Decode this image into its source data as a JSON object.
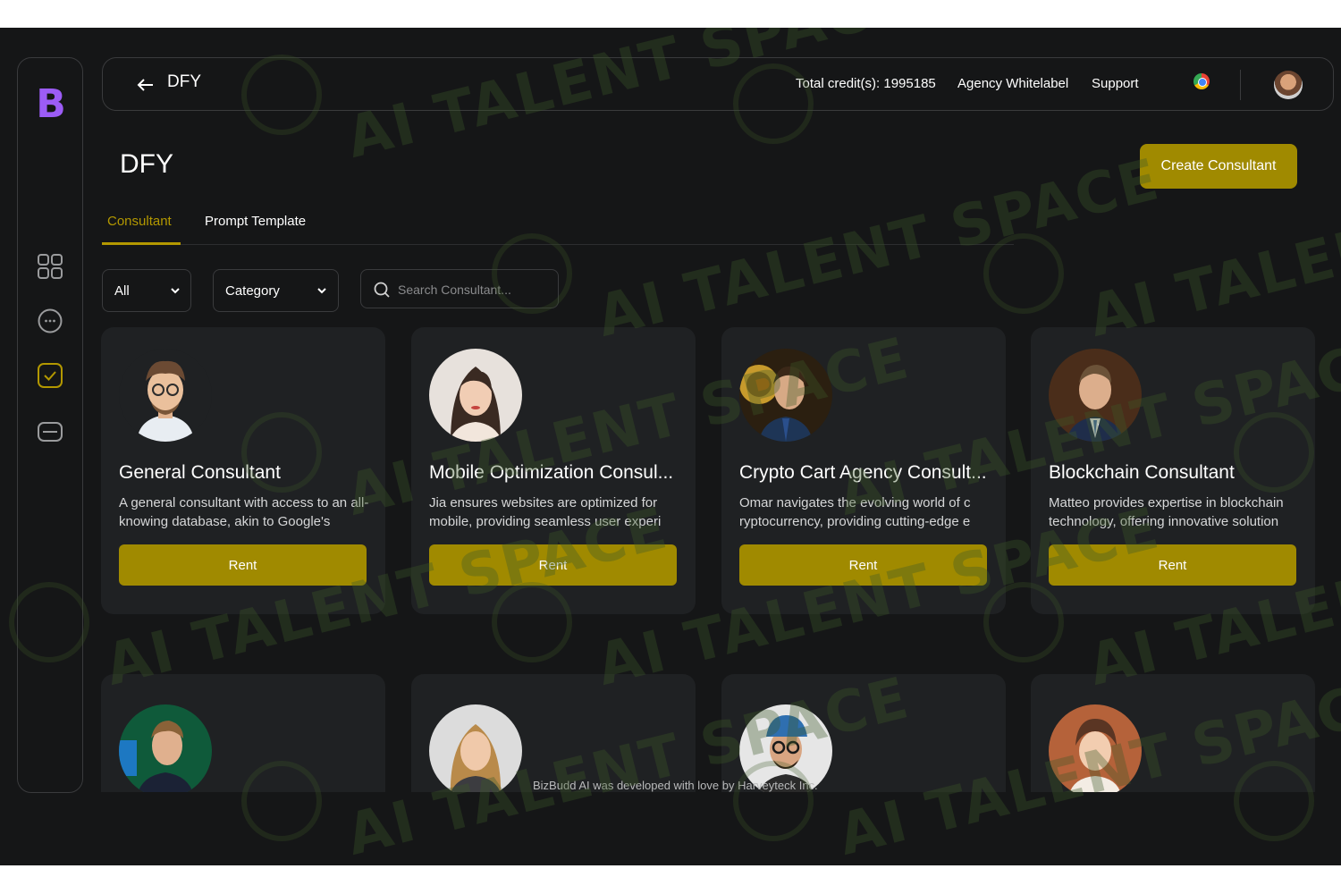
{
  "brand": {
    "logo_letter": "B",
    "accent": "#a08a00",
    "tab_accent": "#b39800",
    "logo_color": "#9c5cf6"
  },
  "sidebar": {
    "items": [
      {
        "icon": "grid-icon"
      },
      {
        "icon": "chat-bubble-icon"
      },
      {
        "icon": "check-square-icon",
        "active": true
      },
      {
        "icon": "card-icon"
      }
    ]
  },
  "topbar": {
    "title": "DFY",
    "credits": "Total credit(s): 1995185",
    "links": [
      "Agency Whitelabel",
      "Support"
    ]
  },
  "page": {
    "title": "DFY",
    "create_button": "Create Consultant"
  },
  "tabs": [
    {
      "label": "Consultant",
      "active": true
    },
    {
      "label": "Prompt Template",
      "active": false
    }
  ],
  "filters": {
    "type_select": "All",
    "category_select": "Category",
    "search_placeholder": "Search Consultant..."
  },
  "consultants": [
    {
      "name": "General Consultant",
      "description": "A general consultant with access to an all-knowing database, akin to Google's",
      "rent_label": "Rent"
    },
    {
      "name": "Mobile Optimization Consul...",
      "description": "Jia ensures websites are optimized for mobile, providing seamless user experi",
      "rent_label": "Rent"
    },
    {
      "name": "Crypto Cart Agency Consult...",
      "description": "Omar navigates the evolving world of c ryptocurrency, providing cutting-edge e",
      "rent_label": "Rent"
    },
    {
      "name": "Blockchain Consultant",
      "description": "Matteo provides expertise in blockchain technology, offering innovative solution",
      "rent_label": "Rent"
    }
  ],
  "footer": {
    "text": "BizBudd AI was developed with love by Harveyteck Inc."
  },
  "watermark": {
    "text": "AI TALENT SPACE"
  }
}
